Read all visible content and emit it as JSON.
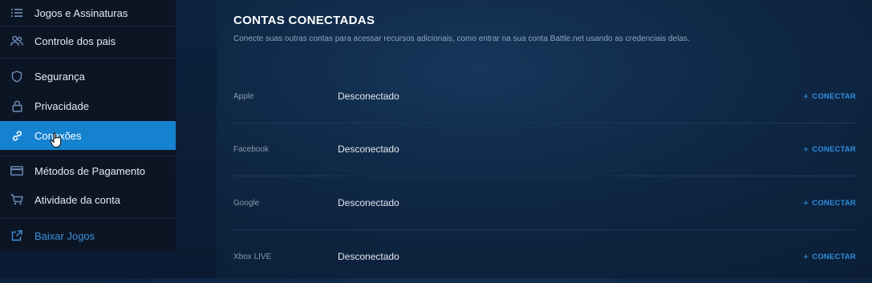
{
  "sidebar": {
    "items": [
      {
        "label": "Jogos e Assinaturas",
        "icon": "list-icon"
      },
      {
        "label": "Controle dos pais",
        "icon": "users-icon"
      },
      {
        "label": "Segurança",
        "icon": "shield-icon"
      },
      {
        "label": "Privacidade",
        "icon": "lock-icon"
      },
      {
        "label": "Conexões",
        "icon": "link-icon",
        "active": true
      },
      {
        "label": "Métodos de Pagamento",
        "icon": "credit-card-icon"
      },
      {
        "label": "Atividade da conta",
        "icon": "cart-icon"
      },
      {
        "label": "Baixar Jogos",
        "icon": "external-link-icon"
      }
    ]
  },
  "main": {
    "title": "CONTAS CONECTADAS",
    "subtitle": "Conecte suas outras contas para acessar recursos adicionais, como entrar na sua conta Battle.net usando as credenciais delas.",
    "accounts": [
      {
        "service": "Apple",
        "status": "Desconectado",
        "action": "CONECTAR"
      },
      {
        "service": "Facebook",
        "status": "Desconectado",
        "action": "CONECTAR"
      },
      {
        "service": "Google",
        "status": "Desconectado",
        "action": "CONECTAR"
      },
      {
        "service": "Xbox LIVE",
        "status": "Desconectado",
        "action": "CONECTAR"
      }
    ],
    "action_prefix": "+"
  },
  "colors": {
    "accent": "#1582d0",
    "link": "#2f8fe0",
    "sidebar_bg": "#0b1524",
    "page_bg": "#0e2744"
  }
}
